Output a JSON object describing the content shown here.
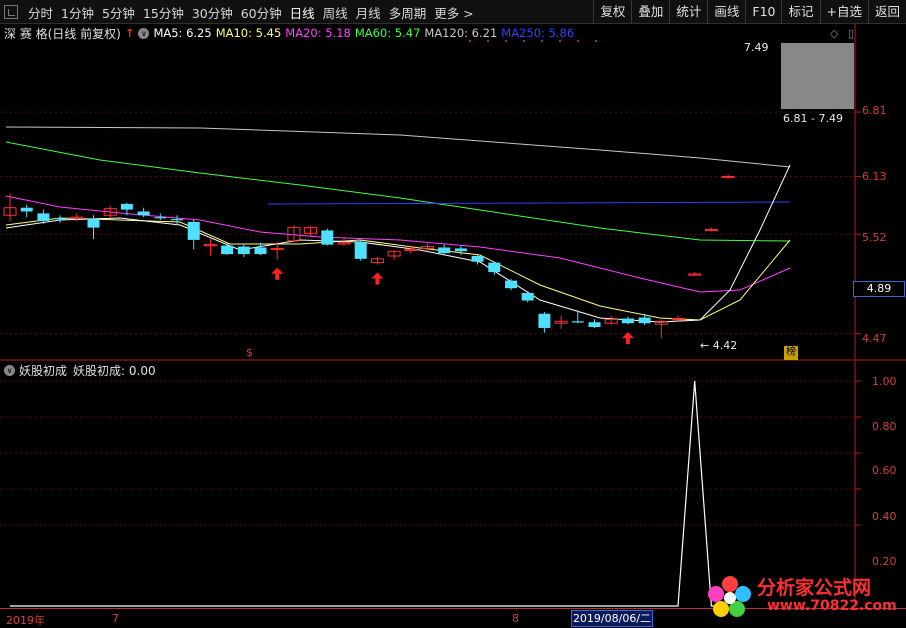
{
  "toolbar": {
    "periods": [
      "分时",
      "1分钟",
      "5分钟",
      "15分钟",
      "30分钟",
      "60分钟",
      "日线",
      "周线",
      "月线",
      "多周期",
      "更多 >"
    ],
    "active_period": "日线",
    "right_buttons": [
      "复权",
      "叠加",
      "统计",
      "画线",
      "F10",
      "标记",
      "+自选",
      "返回"
    ]
  },
  "info": {
    "stock": "深 赛 格(日线 前复权)",
    "ma5": "MA5: 6.25",
    "ma10": "MA10: 5.45",
    "ma20": "MA20: 5.18",
    "ma60": "MA60: 5.47",
    "ma120": "MA120: 6.21",
    "ma250": "MA250: 5.86"
  },
  "colors": {
    "ma5": "#ffffff",
    "ma10": "#ffff80",
    "ma20": "#ff40ff",
    "ma60": "#40ff40",
    "ma120": "#c8c8c8",
    "ma250": "#3040ff",
    "up": "#ff3030",
    "down": "#50e0ff"
  },
  "price_axis": [
    "6.81",
    "6.13",
    "5.52",
    "4.47"
  ],
  "current_price": "4.89",
  "high_label": "7.49",
  "range_label": "6.81 - 7.49",
  "low_label": "4.42",
  "bang_label": "榜",
  "dollar_label": "$",
  "indicator": {
    "title": "妖股初成",
    "value_label": "妖股初成: 0.00",
    "axis": [
      "1.00",
      "0.80",
      "0.60",
      "0.40",
      "0.20"
    ]
  },
  "xaxis": {
    "labels": [
      "2019年",
      "7",
      "8"
    ],
    "cursor_date": "2019/08/06/二"
  },
  "watermark": {
    "text": "分析家公式网",
    "url": "www.70822.com"
  },
  "chart_data": {
    "type": "candlestick",
    "candles": [
      {
        "o": 5.72,
        "c": 5.8,
        "h": 5.95,
        "l": 5.66,
        "up": true
      },
      {
        "o": 5.8,
        "c": 5.76,
        "h": 5.83,
        "l": 5.7,
        "up": false
      },
      {
        "o": 5.74,
        "c": 5.66,
        "h": 5.78,
        "l": 5.63,
        "up": false
      },
      {
        "o": 5.68,
        "c": 5.69,
        "h": 5.72,
        "l": 5.64,
        "up": false
      },
      {
        "o": 5.7,
        "c": 5.7,
        "h": 5.74,
        "l": 5.66,
        "up": true
      },
      {
        "o": 5.68,
        "c": 5.59,
        "h": 5.72,
        "l": 5.47,
        "up": false
      },
      {
        "o": 5.72,
        "c": 5.79,
        "h": 5.82,
        "l": 5.7,
        "up": true
      },
      {
        "o": 5.78,
        "c": 5.84,
        "h": 5.85,
        "l": 5.72,
        "up": false
      },
      {
        "o": 5.76,
        "c": 5.72,
        "h": 5.8,
        "l": 5.7,
        "up": false
      },
      {
        "o": 5.7,
        "c": 5.69,
        "h": 5.74,
        "l": 5.67,
        "up": false
      },
      {
        "o": 5.68,
        "c": 5.67,
        "h": 5.72,
        "l": 5.62,
        "up": false
      },
      {
        "o": 5.65,
        "c": 5.46,
        "h": 5.67,
        "l": 5.36,
        "up": false
      },
      {
        "o": 5.41,
        "c": 5.4,
        "h": 5.47,
        "l": 5.29,
        "up": true
      },
      {
        "o": 5.4,
        "c": 5.31,
        "h": 5.43,
        "l": 5.3,
        "up": false
      },
      {
        "o": 5.39,
        "c": 5.31,
        "h": 5.42,
        "l": 5.28,
        "up": false
      },
      {
        "o": 5.38,
        "c": 5.31,
        "h": 5.43,
        "l": 5.3,
        "up": false
      },
      {
        "o": 5.37,
        "c": 5.36,
        "h": 5.44,
        "l": 5.25,
        "up": true
      },
      {
        "o": 5.45,
        "c": 5.59,
        "h": 5.61,
        "l": 5.44,
        "up": true
      },
      {
        "o": 5.53,
        "c": 5.59,
        "h": 5.61,
        "l": 5.5,
        "up": true
      },
      {
        "o": 5.56,
        "c": 5.41,
        "h": 5.58,
        "l": 5.4,
        "up": false
      },
      {
        "o": 5.42,
        "c": 5.43,
        "h": 5.48,
        "l": 5.4,
        "up": true
      },
      {
        "o": 5.44,
        "c": 5.26,
        "h": 5.46,
        "l": 5.24,
        "up": false
      },
      {
        "o": 5.22,
        "c": 5.26,
        "h": 5.28,
        "l": 5.2,
        "up": true
      },
      {
        "o": 5.29,
        "c": 5.34,
        "h": 5.35,
        "l": 5.25,
        "up": true
      },
      {
        "o": 5.36,
        "c": 5.36,
        "h": 5.4,
        "l": 5.32,
        "up": true
      },
      {
        "o": 5.37,
        "c": 5.39,
        "h": 5.42,
        "l": 5.35,
        "up": true
      },
      {
        "o": 5.38,
        "c": 5.32,
        "h": 5.41,
        "l": 5.31,
        "up": false
      },
      {
        "o": 5.37,
        "c": 5.34,
        "h": 5.4,
        "l": 5.3,
        "up": false
      },
      {
        "o": 5.29,
        "c": 5.23,
        "h": 5.3,
        "l": 5.2,
        "up": false
      },
      {
        "o": 5.22,
        "c": 5.12,
        "h": 5.23,
        "l": 5.09,
        "up": false
      },
      {
        "o": 5.03,
        "c": 4.95,
        "h": 5.05,
        "l": 4.93,
        "up": false
      },
      {
        "o": 4.9,
        "c": 4.82,
        "h": 4.92,
        "l": 4.8,
        "up": false
      },
      {
        "o": 4.68,
        "c": 4.53,
        "h": 4.7,
        "l": 4.48,
        "up": false
      },
      {
        "o": 4.58,
        "c": 4.6,
        "h": 4.66,
        "l": 4.52,
        "up": true
      },
      {
        "o": 4.6,
        "c": 4.6,
        "h": 4.72,
        "l": 4.58,
        "up": false
      },
      {
        "o": 4.59,
        "c": 4.54,
        "h": 4.62,
        "l": 4.53,
        "up": false
      },
      {
        "o": 4.58,
        "c": 4.62,
        "h": 4.66,
        "l": 4.56,
        "up": true
      },
      {
        "o": 4.63,
        "c": 4.58,
        "h": 4.65,
        "l": 4.57,
        "up": false
      },
      {
        "o": 4.64,
        "c": 4.58,
        "h": 4.68,
        "l": 4.56,
        "up": false
      },
      {
        "o": 4.6,
        "c": 4.57,
        "h": 4.62,
        "l": 4.42,
        "up": true
      },
      {
        "o": 4.63,
        "c": 4.63,
        "h": 4.66,
        "l": 4.6,
        "up": true
      },
      {
        "o": 5.1,
        "c": 5.1,
        "h": 5.12,
        "l": 5.08,
        "up": true
      },
      {
        "o": 5.57,
        "c": 5.57,
        "h": 5.59,
        "l": 5.55,
        "up": true
      },
      {
        "o": 6.13,
        "c": 6.13,
        "h": 6.15,
        "l": 6.11,
        "up": true
      }
    ],
    "arrow_candles": [
      16,
      22,
      37
    ],
    "indicator_values": [
      0,
      0,
      0,
      0,
      0,
      0,
      0,
      0,
      0,
      0,
      0,
      0,
      0,
      0,
      0,
      0,
      0,
      0,
      0,
      0,
      0,
      0,
      0,
      0,
      0,
      0,
      0,
      0,
      0,
      0,
      0,
      0,
      0,
      0,
      0,
      0,
      0,
      0,
      0,
      0,
      0,
      1,
      0,
      0
    ],
    "ylim": [
      4.35,
      7.55
    ],
    "indicator_ylim": [
      0,
      1.1
    ]
  }
}
